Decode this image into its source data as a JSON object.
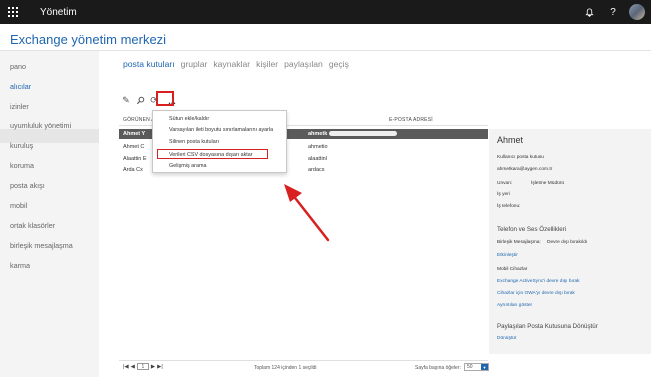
{
  "topbar": {
    "app_name": "Yönetim",
    "bell_glyph": "🔔",
    "help_glyph": "?"
  },
  "header": {
    "title": "Exchange yönetim merkezi"
  },
  "nav": {
    "items": [
      {
        "label": "pano",
        "active": false
      },
      {
        "label": "alıcılar",
        "active": true
      },
      {
        "label": "izinler",
        "active": false
      },
      {
        "label": "uyumluluk yönetimi",
        "active": false
      },
      {
        "label": "kuruluş",
        "active": false
      },
      {
        "label": "koruma",
        "active": false
      },
      {
        "label": "posta akışı",
        "active": false
      },
      {
        "label": "mobil",
        "active": false
      },
      {
        "label": "ortak klasörler",
        "active": false
      },
      {
        "label": "birleşik mesajlaşma",
        "active": false
      },
      {
        "label": "karma",
        "active": false
      }
    ]
  },
  "tabs": [
    {
      "label": "posta kutuları",
      "active": true
    },
    {
      "label": "gruplar",
      "active": false
    },
    {
      "label": "kaynaklar",
      "active": false
    },
    {
      "label": "kişiler",
      "active": false
    },
    {
      "label": "paylaşılan",
      "active": false
    },
    {
      "label": "geçiş",
      "active": false
    }
  ],
  "toolbar": {
    "edit_glyph": "✎",
    "search_glyph": "⚲",
    "refresh_glyph": "⟳",
    "more_label": "..."
  },
  "table": {
    "headers": {
      "display_name": "GÖRÜNEN AD",
      "email": "E-POSTA ADRESİ"
    },
    "rows": [
      {
        "name": "Ahmet Y",
        "email": "ahmetk",
        "selected": true
      },
      {
        "name": "Ahmet C",
        "email": "ahmetio",
        "selected": false
      },
      {
        "name": "Alaattin E",
        "email": "alaattinl",
        "selected": false
      },
      {
        "name": "Arda Cx",
        "email": "ardacs",
        "selected": false
      }
    ]
  },
  "menu": {
    "items": [
      "Sütun ekle/kaldır",
      "Varsayılan ileti boyutu sınırlamalarını ayarla",
      "Silinen posta kutuları",
      "Verileri CSV dosyasına dışarı aktar",
      "Gelişmiş arama"
    ],
    "highlighted_index": 3
  },
  "footer": {
    "page_value": "1",
    "total_text": "Toplam 124 içinden 1 seçildi",
    "page_size_label": "Sayfa başına öğeler:",
    "page_size_value": "50"
  },
  "details": {
    "name": "Ahmet",
    "type": "Kullanıcı posta kutusu",
    "email": "ahmetkara@aygen.com.tr",
    "title_label": "Unvan:",
    "title_value": "İşletme Müdürü",
    "workplace_label": "İş yeri",
    "phone_label": "İş telefonu:",
    "phone_section": "Telefon ve Ses Özellikleri",
    "um_label": "Birleşik Mesajlaşma:",
    "um_value": "Devre dışı bırakıldı",
    "um_enable": "Etkinleştir",
    "mobile_label": "Mobil Cihazlar",
    "eas_link": "Exchange ActiveSync'i devre dışı bırak",
    "owa_link": "Cihazlar için OWA'yı devre dışı bırak",
    "details_link": "Ayrıntıları göster",
    "shared_section": "Paylaşılan Posta Kutusuna Dönüştür",
    "convert_link": "Dönüştür"
  },
  "colors": {
    "accent": "#1f66b0",
    "highlight": "#d82020",
    "topbar": "#1a1a1a"
  },
  "icons": [
    "app-launcher-icon",
    "bell-icon",
    "help-icon",
    "edit-icon",
    "search-icon",
    "refresh-icon",
    "more-icon",
    "first-page-icon",
    "prev-page-icon",
    "next-page-icon",
    "last-page-icon"
  ]
}
